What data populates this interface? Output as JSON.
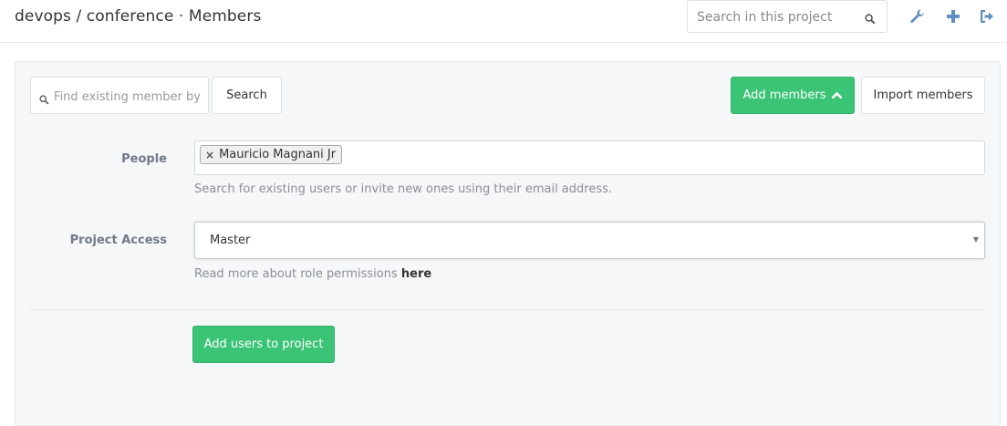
{
  "header": {
    "title": "devops / conference · Members",
    "search_placeholder": "Search in this project",
    "icons": [
      "wrench-icon",
      "plus-icon",
      "sign-out-icon"
    ]
  },
  "toolbar": {
    "find_placeholder": "Find existing member by name",
    "search_button": "Search",
    "add_members_button": "Add members",
    "import_members_button": "Import members"
  },
  "form": {
    "people_label": "People",
    "people_tokens": [
      "Mauricio Magnani Jr"
    ],
    "people_help": "Search for existing users or invite new ones using their email address.",
    "access_label": "Project Access",
    "access_value": "Master",
    "access_help_prefix": "Read more about role permissions",
    "access_help_link": "here",
    "submit_button": "Add users to project"
  },
  "colors": {
    "green": "#3bc476",
    "icon": "#5f8fc2"
  }
}
